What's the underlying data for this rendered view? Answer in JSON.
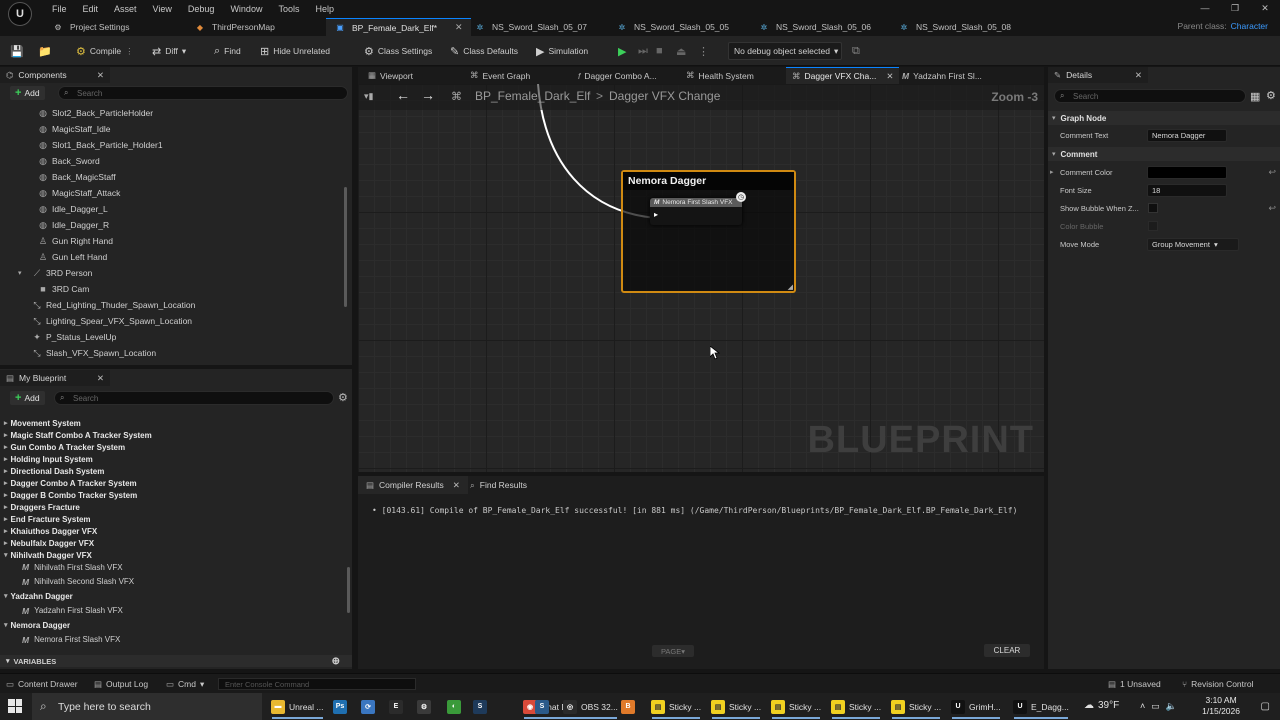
{
  "menubar": {
    "logo": "U",
    "items": [
      "File",
      "Edit",
      "Asset",
      "View",
      "Debug",
      "Window",
      "Tools",
      "Help"
    ]
  },
  "doc_tabs": [
    {
      "label": "Project Settings"
    },
    {
      "label": "ThirdPersonMap"
    },
    {
      "label": "BP_Female_Dark_Elf*"
    },
    {
      "label": "NS_Sword_Slash_05_07"
    },
    {
      "label": "NS_Sword_Slash_05_05"
    },
    {
      "label": "NS_Sword_Slash_05_06"
    },
    {
      "label": "NS_Sword_Slash_05_08"
    }
  ],
  "parent_class": {
    "label": "Parent class:",
    "value": "Character"
  },
  "toolbar": {
    "compile": "Compile",
    "diff": "Diff",
    "find": "Find",
    "hide_unrelated": "Hide Unrelated",
    "class_settings": "Class Settings",
    "class_defaults": "Class Defaults",
    "simulation": "Simulation",
    "debug_object": "No debug object selected"
  },
  "components": {
    "title": "Components",
    "add_label": "Add",
    "search_placeholder": "Search",
    "items": [
      {
        "label": "Slot2_Back_ParticleHolder",
        "icon": "sphere-icon"
      },
      {
        "label": "MagicStaff_Idle",
        "icon": "sphere-icon"
      },
      {
        "label": "Slot1_Back_Particle_Holder1",
        "icon": "sphere-icon"
      },
      {
        "label": "Back_Sword",
        "icon": "sphere-icon"
      },
      {
        "label": "Back_MagicStaff",
        "icon": "sphere-icon"
      },
      {
        "label": "MagicStaff_Attack",
        "icon": "sphere-icon"
      },
      {
        "label": "Idle_Dagger_L",
        "icon": "sphere-icon"
      },
      {
        "label": "Idle_Dagger_R",
        "icon": "sphere-icon"
      },
      {
        "label": "Gun Right Hand",
        "icon": "person-icon"
      },
      {
        "label": "Gun Left Hand",
        "icon": "person-icon"
      },
      {
        "label": "3RD Person",
        "icon": "camera-arm-icon"
      },
      {
        "label": "3RD Cam",
        "icon": "camera-icon"
      },
      {
        "label": "Red_Lighting_Thuder_Spawn_Location",
        "icon": "arrow-icon"
      },
      {
        "label": "Lighting_Spear_VFX_Spawn_Location",
        "icon": "arrow-icon"
      },
      {
        "label": "P_Status_LevelUp",
        "icon": "particle-icon"
      },
      {
        "label": "Slash_VFX_Spawn_Location",
        "icon": "arrow-icon"
      }
    ]
  },
  "my_blueprint": {
    "title": "My Blueprint",
    "add_label": "Add",
    "search_placeholder": "Search",
    "items": [
      {
        "label": "Movement System",
        "kind": "cat"
      },
      {
        "label": "Magic Staff Combo A Tracker System",
        "kind": "cat"
      },
      {
        "label": "Gun Combo A Tracker System",
        "kind": "cat"
      },
      {
        "label": "Holding Input System",
        "kind": "cat"
      },
      {
        "label": "Directional Dash System",
        "kind": "cat"
      },
      {
        "label": "Dagger Combo A Tracker System",
        "kind": "cat"
      },
      {
        "label": "Dagger B Combo Tracker System",
        "kind": "cat"
      },
      {
        "label": "Draggers Fracture",
        "kind": "cat"
      },
      {
        "label": "End Fracture System",
        "kind": "cat"
      },
      {
        "label": "Khaiuthos Dagger VFX",
        "kind": "cat"
      },
      {
        "label": "Nebulfalx Dagger VFX",
        "kind": "cat"
      },
      {
        "label": "Nihilvath Dagger VFX",
        "kind": "cat-open"
      },
      {
        "label": "Nihilvath First Slash VFX",
        "kind": "fn"
      },
      {
        "label": "Nihilvath Second Slash VFX",
        "kind": "fn"
      },
      {
        "label": "Yadzahn Dagger",
        "kind": "cat-open"
      },
      {
        "label": "Yadzahn First Slash VFX",
        "kind": "fn"
      },
      {
        "label": "Nemora Dagger",
        "kind": "cat-open"
      },
      {
        "label": "Nemora First Slash VFX",
        "kind": "fn"
      }
    ],
    "variables_label": "VARIABLES"
  },
  "graph_tabs": [
    {
      "label": "Viewport"
    },
    {
      "label": "Event Graph"
    },
    {
      "label": "Dagger Combo A..."
    },
    {
      "label": "Health System"
    },
    {
      "label": "Dagger VFX Cha..."
    },
    {
      "label": "Yadzahn First Sl..."
    }
  ],
  "graph": {
    "breadcrumb_root": "BP_Female_Dark_Elf",
    "breadcrumb_sep": ">",
    "breadcrumb_leaf": "Dagger VFX Change",
    "zoom": "Zoom -3",
    "watermark": "BLUEPRINT",
    "comment_title": "Nemora Dagger",
    "function_node_title": "Nemora First Slash VFX",
    "colors": {
      "comment_border": "#d08a12",
      "wire": "#ffffff"
    }
  },
  "results": {
    "tab_compiler": "Compiler Results",
    "tab_find": "Find Results",
    "line": "[0143.61] Compile of BP_Female_Dark_Elf successful! [in 881 ms] (/Game/ThirdPerson/Blueprints/BP_Female_Dark_Elf.BP_Female_Dark_Elf)",
    "page_label": "PAGE",
    "clear_label": "CLEAR"
  },
  "details": {
    "title": "Details",
    "search_placeholder": "Search",
    "section_graph_node": "Graph Node",
    "comment_text_label": "Comment Text",
    "comment_text_value": "Nemora Dagger",
    "section_comment": "Comment",
    "comment_color_label": "Comment Color",
    "comment_color_value": "#000000",
    "font_size_label": "Font Size",
    "font_size_value": "18",
    "show_bubble_label": "Show Bubble When Z...",
    "color_bubble_label": "Color Bubble",
    "move_mode_label": "Move Mode",
    "move_mode_value": "Group Movement"
  },
  "statusbar": {
    "content_drawer": "Content Drawer",
    "output_log": "Output Log",
    "cmd": "Cmd",
    "console_placeholder": "Enter Console Command",
    "unsaved": "1 Unsaved",
    "revision_control": "Revision Control"
  },
  "taskbar": {
    "search_placeholder": "Type here to search",
    "apps": [
      {
        "label": "Unreal ...",
        "icon": "folder-icon",
        "color": "#e8b830"
      },
      {
        "label": "",
        "icon": "photoshop-icon",
        "color": "#1f6fb0"
      },
      {
        "label": "",
        "icon": "sync-icon",
        "color": "#3a76c0"
      },
      {
        "label": "",
        "icon": "epic-icon",
        "color": "#2b2b2b"
      },
      {
        "label": "",
        "icon": "gear-app-icon",
        "color": "#3a3a3a"
      },
      {
        "label": "",
        "icon": "palette-icon",
        "color": "#3a9a3a"
      },
      {
        "label": "",
        "icon": "steam-icon",
        "color": "#1e3a5a"
      },
      {
        "label": "Chat D...",
        "icon": "chrome-icon",
        "color": "#d84a3a"
      },
      {
        "label": "",
        "icon": "steam2-icon",
        "color": "#2b5a8a"
      },
      {
        "label": "OBS 32...",
        "icon": "obs-icon",
        "color": "#2a2a2a"
      },
      {
        "label": "",
        "icon": "blender-icon",
        "color": "#e07a2a"
      },
      {
        "label": "Sticky ...",
        "icon": "sticky-icon",
        "color": "#f0d020"
      },
      {
        "label": "Sticky ...",
        "icon": "sticky-icon",
        "color": "#f0d020"
      },
      {
        "label": "Sticky ...",
        "icon": "sticky-icon",
        "color": "#f0d020"
      },
      {
        "label": "Sticky ...",
        "icon": "sticky-icon",
        "color": "#f0d020"
      },
      {
        "label": "Sticky ...",
        "icon": "sticky-icon",
        "color": "#f0d020"
      },
      {
        "label": "GrimH...",
        "icon": "unreal-icon",
        "color": "#111111"
      },
      {
        "label": "E_Dagg...",
        "icon": "unreal-icon",
        "color": "#111111"
      }
    ],
    "weather": "39°F",
    "time": "3:10 AM",
    "date": "1/15/2026"
  }
}
